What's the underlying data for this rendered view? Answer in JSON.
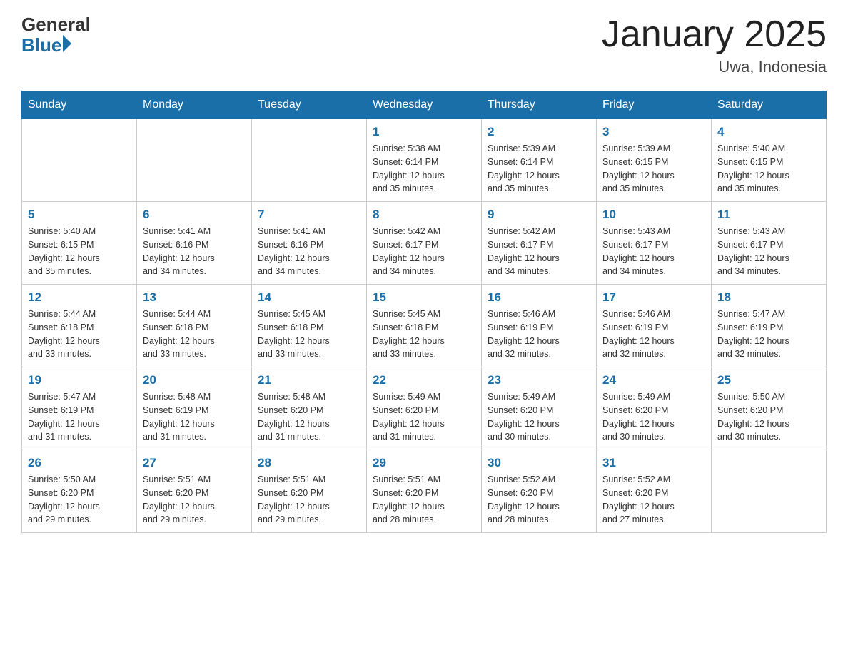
{
  "header": {
    "logo_general": "General",
    "logo_blue": "Blue",
    "title": "January 2025",
    "location": "Uwa, Indonesia"
  },
  "days_of_week": [
    "Sunday",
    "Monday",
    "Tuesday",
    "Wednesday",
    "Thursday",
    "Friday",
    "Saturday"
  ],
  "weeks": [
    [
      {
        "day": "",
        "info": ""
      },
      {
        "day": "",
        "info": ""
      },
      {
        "day": "",
        "info": ""
      },
      {
        "day": "1",
        "info": "Sunrise: 5:38 AM\nSunset: 6:14 PM\nDaylight: 12 hours\nand 35 minutes."
      },
      {
        "day": "2",
        "info": "Sunrise: 5:39 AM\nSunset: 6:14 PM\nDaylight: 12 hours\nand 35 minutes."
      },
      {
        "day": "3",
        "info": "Sunrise: 5:39 AM\nSunset: 6:15 PM\nDaylight: 12 hours\nand 35 minutes."
      },
      {
        "day": "4",
        "info": "Sunrise: 5:40 AM\nSunset: 6:15 PM\nDaylight: 12 hours\nand 35 minutes."
      }
    ],
    [
      {
        "day": "5",
        "info": "Sunrise: 5:40 AM\nSunset: 6:15 PM\nDaylight: 12 hours\nand 35 minutes."
      },
      {
        "day": "6",
        "info": "Sunrise: 5:41 AM\nSunset: 6:16 PM\nDaylight: 12 hours\nand 34 minutes."
      },
      {
        "day": "7",
        "info": "Sunrise: 5:41 AM\nSunset: 6:16 PM\nDaylight: 12 hours\nand 34 minutes."
      },
      {
        "day": "8",
        "info": "Sunrise: 5:42 AM\nSunset: 6:17 PM\nDaylight: 12 hours\nand 34 minutes."
      },
      {
        "day": "9",
        "info": "Sunrise: 5:42 AM\nSunset: 6:17 PM\nDaylight: 12 hours\nand 34 minutes."
      },
      {
        "day": "10",
        "info": "Sunrise: 5:43 AM\nSunset: 6:17 PM\nDaylight: 12 hours\nand 34 minutes."
      },
      {
        "day": "11",
        "info": "Sunrise: 5:43 AM\nSunset: 6:17 PM\nDaylight: 12 hours\nand 34 minutes."
      }
    ],
    [
      {
        "day": "12",
        "info": "Sunrise: 5:44 AM\nSunset: 6:18 PM\nDaylight: 12 hours\nand 33 minutes."
      },
      {
        "day": "13",
        "info": "Sunrise: 5:44 AM\nSunset: 6:18 PM\nDaylight: 12 hours\nand 33 minutes."
      },
      {
        "day": "14",
        "info": "Sunrise: 5:45 AM\nSunset: 6:18 PM\nDaylight: 12 hours\nand 33 minutes."
      },
      {
        "day": "15",
        "info": "Sunrise: 5:45 AM\nSunset: 6:18 PM\nDaylight: 12 hours\nand 33 minutes."
      },
      {
        "day": "16",
        "info": "Sunrise: 5:46 AM\nSunset: 6:19 PM\nDaylight: 12 hours\nand 32 minutes."
      },
      {
        "day": "17",
        "info": "Sunrise: 5:46 AM\nSunset: 6:19 PM\nDaylight: 12 hours\nand 32 minutes."
      },
      {
        "day": "18",
        "info": "Sunrise: 5:47 AM\nSunset: 6:19 PM\nDaylight: 12 hours\nand 32 minutes."
      }
    ],
    [
      {
        "day": "19",
        "info": "Sunrise: 5:47 AM\nSunset: 6:19 PM\nDaylight: 12 hours\nand 31 minutes."
      },
      {
        "day": "20",
        "info": "Sunrise: 5:48 AM\nSunset: 6:19 PM\nDaylight: 12 hours\nand 31 minutes."
      },
      {
        "day": "21",
        "info": "Sunrise: 5:48 AM\nSunset: 6:20 PM\nDaylight: 12 hours\nand 31 minutes."
      },
      {
        "day": "22",
        "info": "Sunrise: 5:49 AM\nSunset: 6:20 PM\nDaylight: 12 hours\nand 31 minutes."
      },
      {
        "day": "23",
        "info": "Sunrise: 5:49 AM\nSunset: 6:20 PM\nDaylight: 12 hours\nand 30 minutes."
      },
      {
        "day": "24",
        "info": "Sunrise: 5:49 AM\nSunset: 6:20 PM\nDaylight: 12 hours\nand 30 minutes."
      },
      {
        "day": "25",
        "info": "Sunrise: 5:50 AM\nSunset: 6:20 PM\nDaylight: 12 hours\nand 30 minutes."
      }
    ],
    [
      {
        "day": "26",
        "info": "Sunrise: 5:50 AM\nSunset: 6:20 PM\nDaylight: 12 hours\nand 29 minutes."
      },
      {
        "day": "27",
        "info": "Sunrise: 5:51 AM\nSunset: 6:20 PM\nDaylight: 12 hours\nand 29 minutes."
      },
      {
        "day": "28",
        "info": "Sunrise: 5:51 AM\nSunset: 6:20 PM\nDaylight: 12 hours\nand 29 minutes."
      },
      {
        "day": "29",
        "info": "Sunrise: 5:51 AM\nSunset: 6:20 PM\nDaylight: 12 hours\nand 28 minutes."
      },
      {
        "day": "30",
        "info": "Sunrise: 5:52 AM\nSunset: 6:20 PM\nDaylight: 12 hours\nand 28 minutes."
      },
      {
        "day": "31",
        "info": "Sunrise: 5:52 AM\nSunset: 6:20 PM\nDaylight: 12 hours\nand 27 minutes."
      },
      {
        "day": "",
        "info": ""
      }
    ]
  ]
}
